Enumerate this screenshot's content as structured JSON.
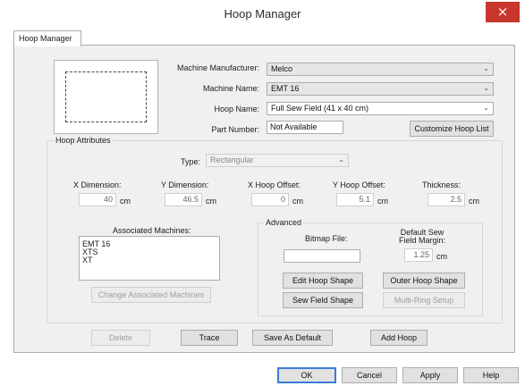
{
  "window": {
    "title": "Hoop Manager",
    "close_glyph": "×"
  },
  "tab": {
    "label": "Hoop Manager"
  },
  "fields": {
    "manufacturer": {
      "label": "Machine Manufacturer:",
      "value": "Melco"
    },
    "machine_name": {
      "label": "Machine Name:",
      "value": "EMT 16"
    },
    "hoop_name": {
      "label": "Hoop Name:",
      "value": "Full Sew Field (41 x 40 cm)"
    },
    "part_number": {
      "label": "Part Number:",
      "value": "Not Available"
    }
  },
  "customize_button": "Customize Hoop List",
  "hoop_attributes": {
    "title": "Hoop Attributes",
    "type_label": "Type:",
    "type_value": "Rectangular",
    "x_dimension": {
      "label": "X Dimension:",
      "value": "40",
      "unit": "cm"
    },
    "y_dimension": {
      "label": "Y Dimension:",
      "value": "46.5",
      "unit": "cm"
    },
    "x_offset": {
      "label": "X Hoop Offset:",
      "value": "0",
      "unit": "cm"
    },
    "y_offset": {
      "label": "Y Hoop Offset:",
      "value": "5.1",
      "unit": "cm"
    },
    "thickness": {
      "label": "Thickness:",
      "value": "2.5",
      "unit": "cm"
    }
  },
  "associated_machines": {
    "label": "Associated Machines:",
    "items": [
      "EMT 16",
      "XTS",
      "XT"
    ],
    "change_button": "Change Associated Machines"
  },
  "advanced": {
    "title": "Advanced",
    "bitmap_label": "Bitmap File:",
    "bitmap_value": "",
    "margin_label_1": "Default Sew",
    "margin_label_2": "Field Margin:",
    "margin_value": "1.25",
    "margin_unit": "cm",
    "edit_hoop_shape": "Edit Hoop Shape",
    "outer_hoop_shape": "Outer Hoop Shape",
    "sew_field_shape": "Sew Field Shape",
    "multi_ring_setup": "Multi-Ring Setup"
  },
  "actions": {
    "delete": "Delete",
    "trace": "Trace",
    "save_as_default": "Save As Default",
    "add_hoop": "Add Hoop"
  },
  "footer": {
    "ok": "OK",
    "cancel": "Cancel",
    "apply": "Apply",
    "help": "Help"
  }
}
